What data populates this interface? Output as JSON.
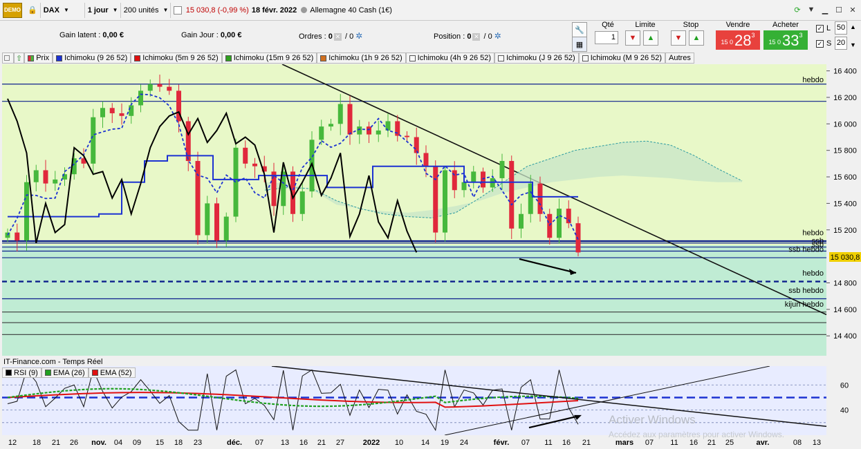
{
  "toolbar": {
    "demo_badge": "DEMO",
    "symbol": "DAX",
    "timeframe": "1 jour",
    "units": "200 unités",
    "price_change": "15 030,8 (-0,99 %)",
    "date": "18 févr. 2022",
    "instrument": "Allemagne 40 Cash (1€)"
  },
  "info": {
    "gain_latent_label": "Gain latent :",
    "gain_latent_value": "0,00 €",
    "gain_jour_label": "Gain Jour :",
    "gain_jour_value": "0,00 €",
    "ordres_label": "Ordres :",
    "ordres_value": "0",
    "ordres_slash": "/ 0",
    "position_label": "Position :",
    "position_value": "0",
    "position_slash": "/ 0"
  },
  "order_panel": {
    "qte_label": "Qté",
    "qte_value": "1",
    "limite_label": "Limite",
    "stop_label": "Stop",
    "vendre_label": "Vendre",
    "vendre_prefix": "15 0",
    "vendre_big": "28",
    "vendre_sup": "3",
    "acheter_label": "Acheter",
    "acheter_prefix": "15 0",
    "acheter_big": "33",
    "acheter_sup": "3",
    "l_label": "L",
    "l_value": "50",
    "s_label": "S",
    "s_value": "20"
  },
  "legend": {
    "prix": "Prix",
    "ichi1": "Ichimoku (9 26 52)",
    "ichi2": "Ichimoku (5m 9 26 52)",
    "ichi3": "Ichimoku (15m 9 26 52)",
    "ichi4": "Ichimoku (1h 9 26 52)",
    "ichi5": "Ichimoku (4h 9 26 52)",
    "ichi6": "Ichimoku (J 9 26 52)",
    "ichi7": "Ichimoku (M 9 26 52)",
    "autres": "Autres"
  },
  "price_axis": [
    "16 400",
    "16 200",
    "16 000",
    "15 800",
    "15 600",
    "15 400",
    "15 200",
    "14 800",
    "14 600",
    "14 400"
  ],
  "current_price_tag": "15 030,8",
  "level_labels": {
    "hebdo_top": "hebdo",
    "hebdo_mid": "hebdo",
    "ssb1": "ssb",
    "ssb2": "ssb",
    "ssb_hebdo1": "ssb hebdo",
    "hebdo_low": "hebdo",
    "ssb_hebdo2": "ssb hebdo",
    "kijun_hebdo": "kijun hebdo"
  },
  "panel_title": "IT-Finance.com - Temps Réel",
  "indicator_legend": {
    "rsi": "RSI (9)",
    "ema26": "EMA (26)",
    "ema52": "EMA (52)"
  },
  "rsi_axis": [
    "60",
    "40"
  ],
  "date_axis": [
    "12",
    "18",
    "21",
    "26",
    "nov.",
    "04",
    "09",
    "15",
    "18",
    "23",
    "déc.",
    "07",
    "13",
    "16",
    "21",
    "27",
    "2022",
    "10",
    "14",
    "19",
    "24",
    "févr.",
    "07",
    "11",
    "16",
    "21",
    "mars",
    "07",
    "11",
    "16",
    "21",
    "25",
    "avr.",
    "08",
    "13"
  ],
  "watermark": {
    "title": "Activer Windows",
    "subtitle": "Accédez aux paramètres pour activer Windows."
  },
  "colors": {
    "bull": "#46b83c",
    "bear": "#e0283c",
    "kijun": "#1c32d2",
    "tenkan": "#1c32d2",
    "chikou": "#000000",
    "cloud_fill": "#c8e6c8",
    "bg_green": "#e8f8c8",
    "level": "#0c1f8c"
  },
  "chart_data": {
    "type": "line",
    "title": "DAX",
    "series": [
      {
        "name": "Prix",
        "values": [
          15180,
          15120,
          15560,
          15650,
          15550,
          15580,
          15620,
          15740,
          15700,
          16050,
          16120,
          16080,
          16060,
          16140,
          16250,
          16300,
          16280,
          16250,
          16020,
          15720,
          15160,
          15400,
          15120,
          15300,
          15820,
          15700,
          15680,
          15640,
          15380,
          15640,
          15320,
          15490,
          15880,
          15980,
          16000,
          16150,
          15920,
          15980,
          15920,
          15950,
          16020,
          15910,
          15900,
          15780,
          15680,
          15180,
          15650,
          15500,
          15560,
          15640,
          15520,
          15590,
          15720,
          15210,
          15320,
          15550,
          15320,
          15140,
          15360,
          15250,
          15030
        ]
      }
    ],
    "ylim": [
      14250,
      16450
    ],
    "levels": [
      16300,
      16170,
      15115,
      15100,
      15070,
      15040,
      14990,
      14810,
      14680,
      14580,
      14500,
      14410
    ]
  }
}
